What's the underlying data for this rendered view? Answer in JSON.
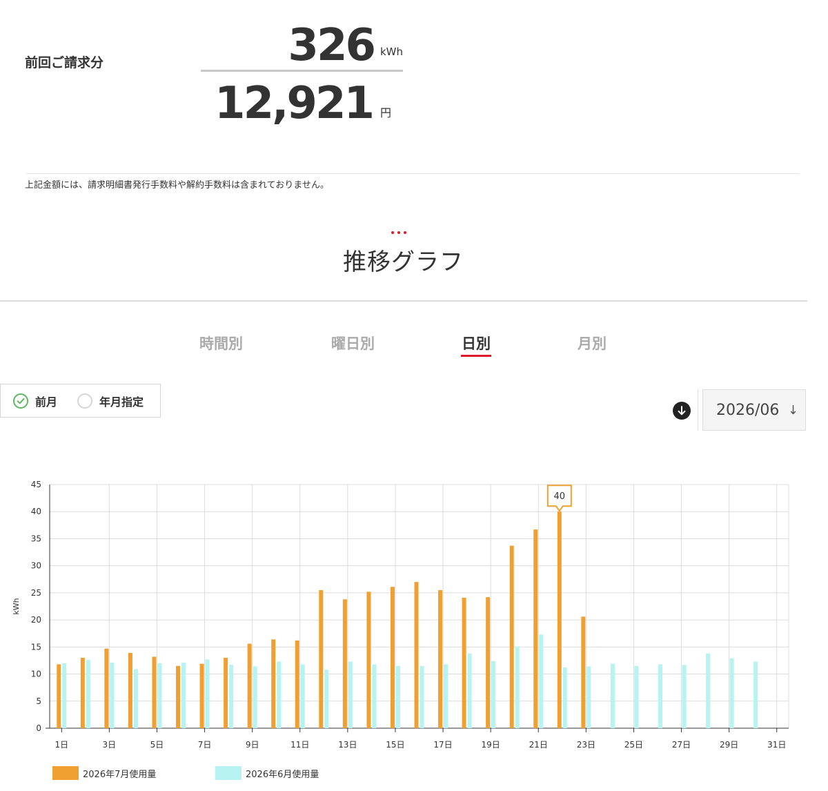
{
  "summary": {
    "label": "前回ご請求分",
    "kwh_value": "326",
    "kwh_unit": "kWh",
    "yen_value": "12,921",
    "yen_unit": "円",
    "note": "上記金額には、請求明細書発行手数料や解約手数料は含まれておりません。"
  },
  "section_title": "推移グラフ",
  "tabs": [
    {
      "label": "時間別",
      "active": false
    },
    {
      "label": "曜日別",
      "active": false
    },
    {
      "label": "日別",
      "active": true
    },
    {
      "label": "月別",
      "active": false
    }
  ],
  "period_options": [
    {
      "label": "前月",
      "checked": true
    },
    {
      "label": "年月指定",
      "checked": false
    }
  ],
  "download_icon": "download-arrow-icon",
  "month_select": {
    "value": "2026/06",
    "arrow": "↓"
  },
  "colors": {
    "accent": "#e0192a",
    "check": "#5cb85c",
    "current": "#f0a030",
    "previous": "#b6f3f1"
  },
  "chart_data": {
    "type": "bar",
    "categories": [
      "1日",
      "2日",
      "3日",
      "4日",
      "5日",
      "6日",
      "7日",
      "8日",
      "9日",
      "10日",
      "11日",
      "12日",
      "13日",
      "14日",
      "15日",
      "16日",
      "17日",
      "18日",
      "19日",
      "20日",
      "21日",
      "22日",
      "23日",
      "24日",
      "25日",
      "26日",
      "27日",
      "28日",
      "29日",
      "30日",
      "31日"
    ],
    "tick_labels": [
      "1日",
      "3日",
      "5日",
      "7日",
      "9日",
      "11日",
      "13日",
      "15日",
      "17日",
      "19日",
      "21日",
      "23日",
      "25日",
      "27日",
      "29日",
      "31日"
    ],
    "series": [
      {
        "name": "2026年7月使用量",
        "values": [
          11.8,
          13.0,
          14.7,
          13.9,
          13.2,
          11.5,
          11.9,
          13.0,
          15.6,
          16.4,
          16.2,
          25.5,
          23.8,
          25.2,
          26.1,
          27.0,
          25.5,
          24.1,
          24.2,
          33.7,
          36.7,
          40,
          20.6,
          null,
          null,
          null,
          null,
          null,
          null,
          null,
          null
        ]
      },
      {
        "name": "2026年6月使用量",
        "values": [
          12.0,
          12.6,
          12.1,
          10.9,
          12.0,
          12.1,
          12.7,
          11.7,
          11.4,
          12.3,
          11.8,
          10.8,
          12.3,
          11.8,
          11.5,
          11.5,
          11.8,
          13.8,
          12.4,
          15.1,
          17.3,
          11.2,
          11.4,
          11.9,
          11.5,
          11.8,
          11.7,
          13.8,
          12.9,
          12.3,
          null
        ]
      }
    ],
    "ylabel": "kWh",
    "ylim": [
      0,
      45
    ],
    "yticks": [
      0,
      5,
      10,
      15,
      20,
      25,
      30,
      35,
      40,
      45
    ],
    "grid": true,
    "legend_position": "bottom-left",
    "tooltip": {
      "series": 0,
      "index": 21,
      "label": "40"
    }
  }
}
